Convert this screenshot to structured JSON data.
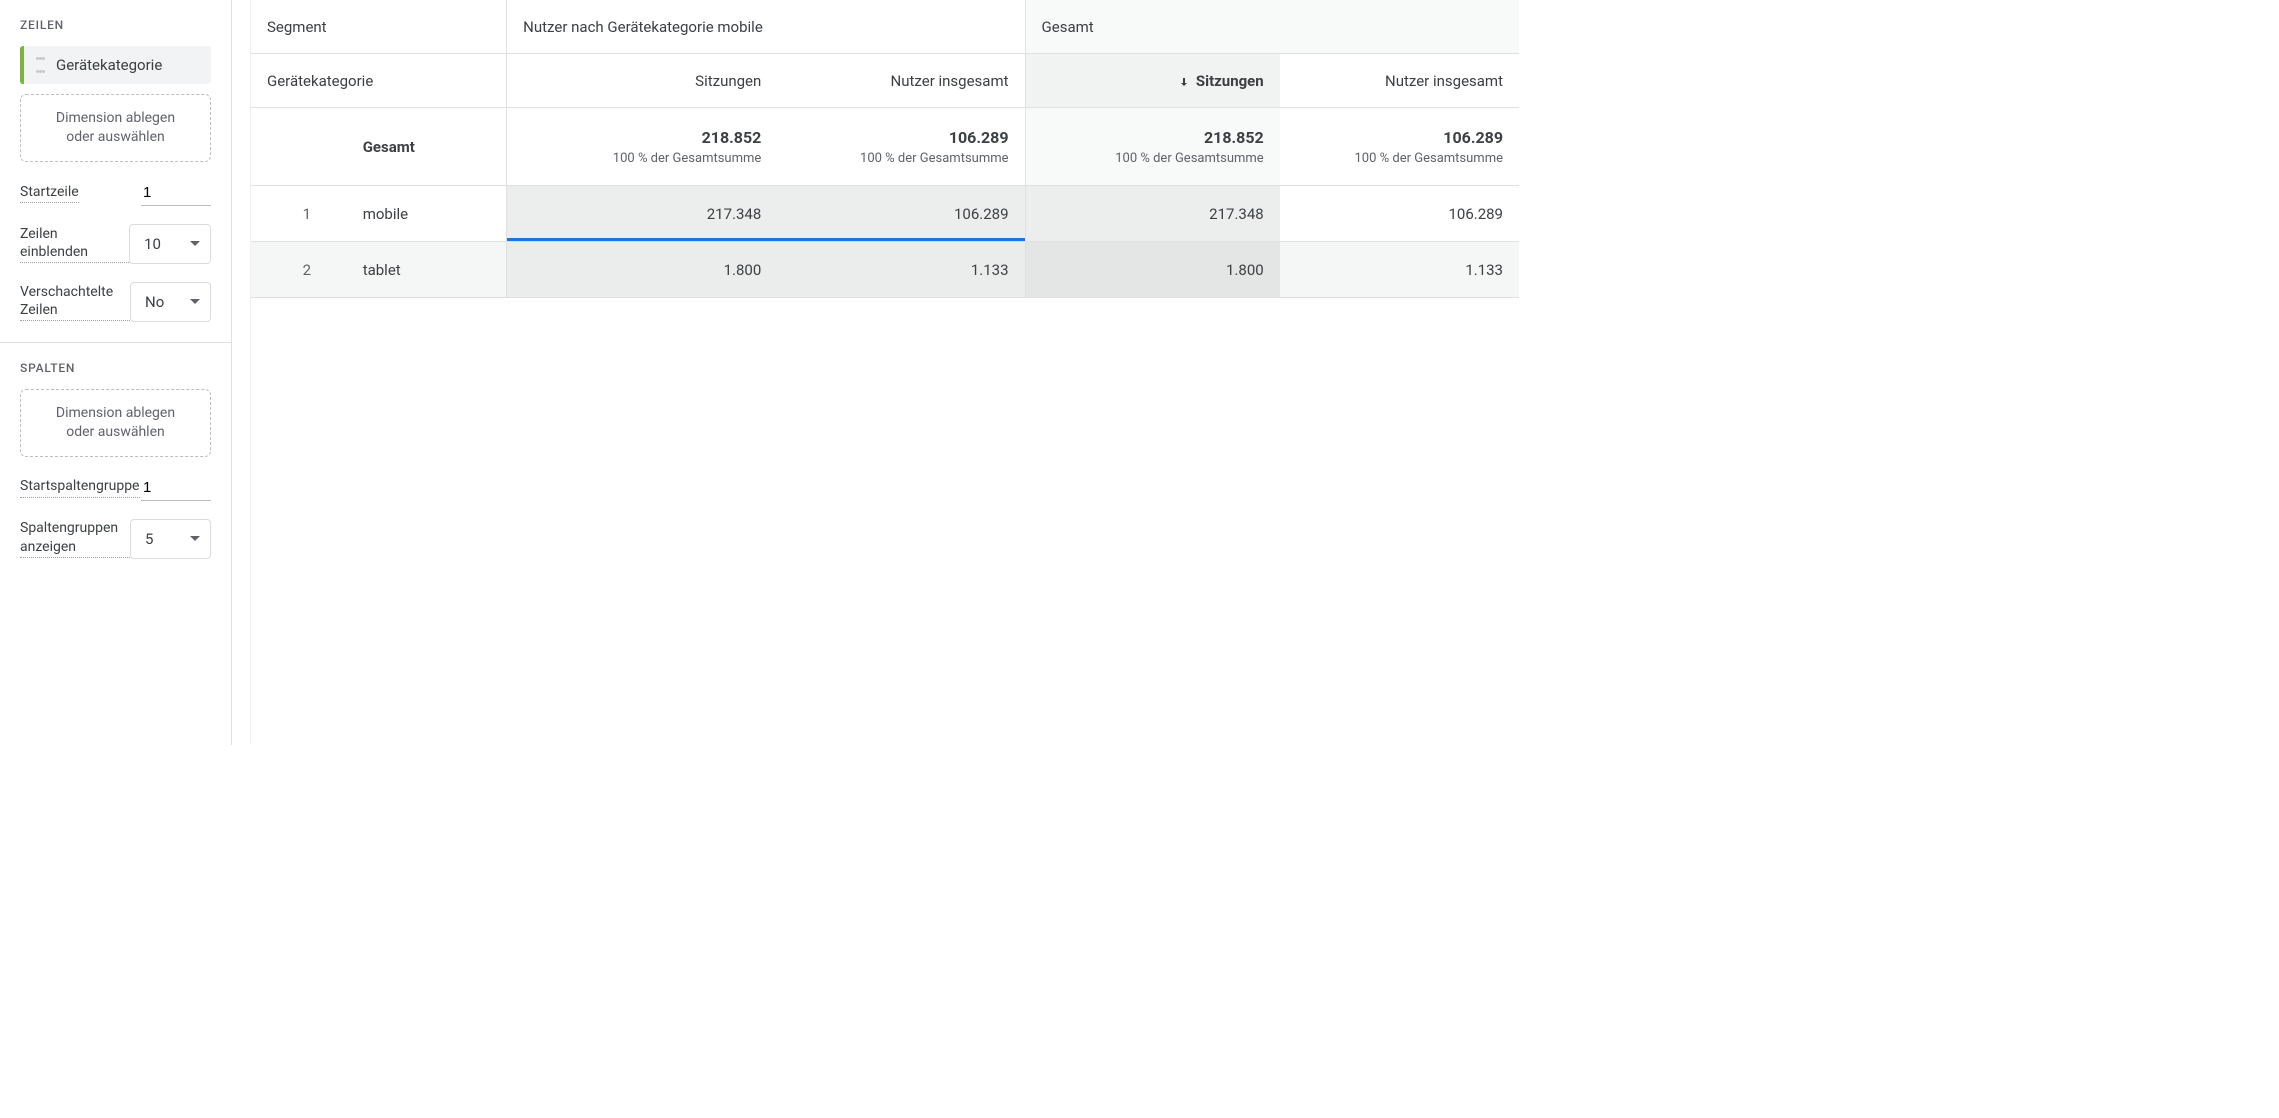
{
  "sidebar": {
    "rows": {
      "title": "ZEILEN",
      "chip": "Gerätekategorie",
      "dropzone": "Dimension ablegen oder auswählen",
      "start_row_label": "Startzeile",
      "start_row_value": "1",
      "show_rows_label": "Zeilen einblenden",
      "show_rows_value": "10",
      "nested_rows_label": "Verschachtelte Zeilen",
      "nested_rows_value": "No"
    },
    "cols": {
      "title": "SPALTEN",
      "dropzone": "Dimension ablegen oder auswählen",
      "start_col_label": "Startspaltengruppe",
      "start_col_value": "1",
      "show_cols_label": "Spaltengruppen anzeigen",
      "show_cols_value": "5"
    }
  },
  "table": {
    "segment_header": "Segment",
    "segment_a": "Nutzer nach Gerätekategorie mobile",
    "segment_b": "Gesamt",
    "dim_header": "Gerätekategorie",
    "metric_sessions": "Sitzungen",
    "metric_users": "Nutzer insgesamt",
    "totals_label": "Gesamt",
    "totals_sub": "100 % der Gesamtsumme",
    "totals": {
      "a_sessions": "218.852",
      "a_users": "106.289",
      "b_sessions": "218.852",
      "b_users": "106.289"
    },
    "rows": [
      {
        "idx": "1",
        "dim": "mobile",
        "a_sessions": "217.348",
        "a_users": "106.289",
        "b_sessions": "217.348",
        "b_users": "106.289"
      },
      {
        "idx": "2",
        "dim": "tablet",
        "a_sessions": "1.800",
        "a_users": "1.133",
        "b_sessions": "1.800",
        "b_users": "1.133"
      }
    ]
  }
}
